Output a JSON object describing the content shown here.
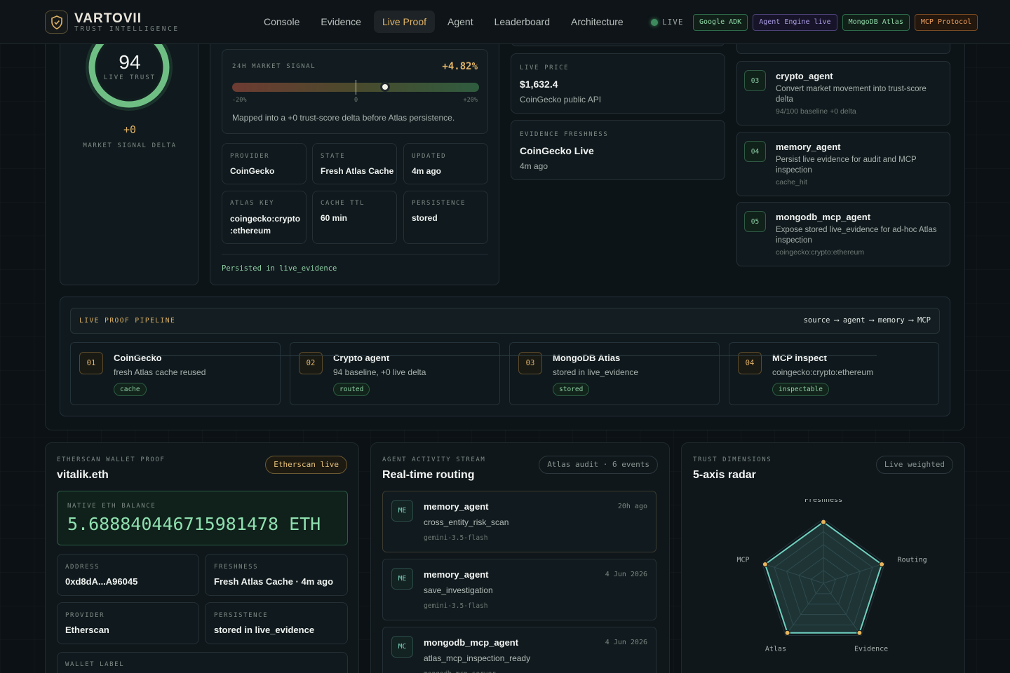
{
  "header": {
    "brand": "VARTOVII",
    "brand_sub": "TRUST INTELLIGENCE",
    "nav": [
      "Console",
      "Evidence",
      "Live Proof",
      "Agent",
      "Leaderboard",
      "Architecture"
    ],
    "nav_active": "Live Proof",
    "live_label": "LIVE",
    "badges": [
      "Google ADK",
      "Agent Engine live",
      "MongoDB Atlas",
      "MCP Protocol"
    ]
  },
  "trust": {
    "score": "94",
    "score_label": "LIVE TRUST",
    "delta": "+0",
    "delta_label": "MARKET SIGNAL DELTA",
    "ring_fraction": 0.94
  },
  "signal": {
    "label": "24H MARKET SIGNAL",
    "value": "+4.82%",
    "min": "-20%",
    "mid": "0",
    "max": "+20%",
    "position_pct": 4.82,
    "note": "Mapped into a +0 trust-score delta before Atlas persistence.",
    "fields": [
      {
        "label": "PROVIDER",
        "value": "CoinGecko"
      },
      {
        "label": "STATE",
        "value": "Fresh Atlas Cache"
      },
      {
        "label": "UPDATED",
        "value": "4m ago"
      },
      {
        "label": "ATLAS KEY",
        "value": "coingecko:crypto\n:ethereum"
      },
      {
        "label": "CACHE TTL",
        "value": "60 min"
      },
      {
        "label": "PERSISTENCE",
        "value": "stored"
      }
    ],
    "footer": "Persisted in live_evidence"
  },
  "price": {
    "label": "LIVE PRICE",
    "value": "$1,632.4",
    "source": "CoinGecko public API"
  },
  "freshness": {
    "label": "EVIDENCE FRESHNESS",
    "value": "CoinGecko Live",
    "age": "4m ago"
  },
  "agents": [
    {
      "num": "03",
      "name": "crypto_agent",
      "desc": "Convert market movement into trust-score delta",
      "meta": "94/100 baseline +0 delta"
    },
    {
      "num": "04",
      "name": "memory_agent",
      "desc": "Persist live evidence for audit and MCP inspection",
      "meta": "cache_hit"
    },
    {
      "num": "05",
      "name": "mongodb_mcp_agent",
      "desc": "Expose stored live_evidence for ad-hoc Atlas inspection",
      "meta": "coingecko:crypto:ethereum"
    }
  ],
  "pipeline": {
    "label": "LIVE PROOF PIPELINE",
    "flow": [
      "source",
      "agent",
      "memory",
      "MCP"
    ],
    "steps": [
      {
        "num": "01",
        "title": "CoinGecko",
        "desc": "fresh Atlas cache reused",
        "chip": "cache"
      },
      {
        "num": "02",
        "title": "Crypto agent",
        "desc": "94 baseline, +0 live delta",
        "chip": "routed"
      },
      {
        "num": "03",
        "title": "MongoDB Atlas",
        "desc": "stored in live_evidence",
        "chip": "stored"
      },
      {
        "num": "04",
        "title": "MCP inspect",
        "desc": "coingecko:crypto:ethereum",
        "chip": "inspectable"
      }
    ]
  },
  "wallet": {
    "label": "ETHERSCAN WALLET PROOF",
    "title": "vitalik.eth",
    "pill": "Etherscan live",
    "balance_label": "NATIVE ETH BALANCE",
    "balance": "5.688840446715981478 ETH",
    "fields": [
      {
        "label": "ADDRESS",
        "value": "0xd8dA...A96045"
      },
      {
        "label": "FRESHNESS",
        "value": "Fresh Atlas Cache · 4m ago"
      },
      {
        "label": "PROVIDER",
        "value": "Etherscan"
      },
      {
        "label": "PERSISTENCE",
        "value": "stored in live_evidence"
      }
    ],
    "wallet_label": "WALLET LABEL"
  },
  "activity": {
    "label": "AGENT ACTIVITY STREAM",
    "title": "Real-time routing",
    "pill": "Atlas audit · 6 events",
    "events": [
      {
        "icon": "ME",
        "agent": "memory_agent",
        "time": "20h ago",
        "event": "cross_entity_risk_scan",
        "model": "gemini-3.5-flash"
      },
      {
        "icon": "ME",
        "agent": "memory_agent",
        "time": "4 Jun 2026",
        "event": "save_investigation",
        "model": "gemini-3.5-flash"
      },
      {
        "icon": "MC",
        "agent": "mongodb_mcp_agent",
        "time": "4 Jun 2026",
        "event": "atlas_mcp_inspection_ready",
        "model": "mongodb-mcp-server"
      }
    ]
  },
  "radar": {
    "label": "TRUST DIMENSIONS",
    "title": "5-axis radar",
    "pill": "Live weighted",
    "chart_data": {
      "type": "radar",
      "axes": [
        "Freshness",
        "Routing",
        "Evidence",
        "Atlas",
        "MCP"
      ],
      "values": [
        0.95,
        0.95,
        0.95,
        0.95,
        0.95
      ],
      "range": [
        0,
        1
      ]
    }
  },
  "colors": {
    "accent": "#e0b366",
    "green": "#8fd8a8",
    "teal": "#6fd0bf",
    "background": "#0b1115"
  }
}
